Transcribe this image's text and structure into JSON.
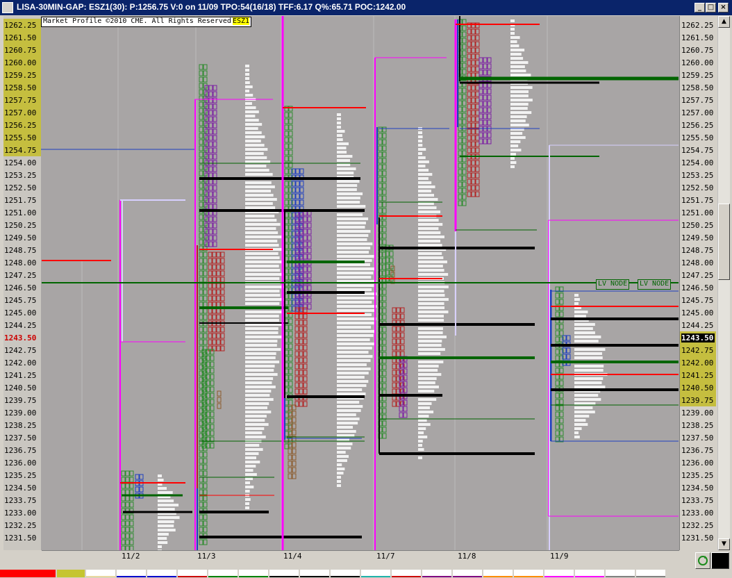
{
  "window": {
    "title": "LISA-30MIN-GAP: ESZ1(30): P:1256.75 V:0 on 11/09 TPO:54(16/18)  TFF:6.17 Q%:65.71 POC:1242.00",
    "minimize": "_",
    "maximize": "□",
    "close": "×"
  },
  "chart_header": {
    "copyright": "Market Profile ©2010 CME. All Rights Reserved",
    "symbol": "ESZ1"
  },
  "price_axis": {
    "prices": [
      "1262.25",
      "1261.50",
      "1260.75",
      "1260.00",
      "1259.25",
      "1258.50",
      "1257.75",
      "1257.00",
      "1256.25",
      "1255.50",
      "1254.75",
      "1254.00",
      "1253.25",
      "1252.50",
      "1251.75",
      "1251.00",
      "1250.25",
      "1249.50",
      "1248.75",
      "1248.00",
      "1247.25",
      "1246.50",
      "1245.75",
      "1245.00",
      "1244.25",
      "1243.50",
      "1242.75",
      "1242.00",
      "1241.25",
      "1240.50",
      "1239.75",
      "1239.00",
      "1238.25",
      "1237.50",
      "1236.75",
      "1236.00",
      "1235.25",
      "1234.50",
      "1233.75",
      "1233.00",
      "1232.25",
      "1231.50"
    ],
    "left_highlight_range": [
      "1262.25",
      "1254.75"
    ],
    "right_highlight_range": [
      "1243.50",
      "1239.75"
    ],
    "current_price_left": "1243.50",
    "current_price_right": "1243.50"
  },
  "dates": [
    "11/2",
    "11/3",
    "11/4",
    "11/7",
    "11/8",
    "11/9"
  ],
  "annotations": {
    "lv_node_1": "LV NODE",
    "lv_node_2": "LV NODE"
  },
  "colors": {
    "chart_bg": "#a8a5a5",
    "title_bg": "#0a246a",
    "highlight": "#c5be3f",
    "green_tpo": "#2e8b2e",
    "red_tpo": "#b22222",
    "purple_tpo": "#7b1fa2",
    "blue_tpo": "#1e3fbf",
    "magenta_line": "#ff00ff"
  },
  "icons": [
    "app-icon",
    "minimize-icon",
    "maximize-icon",
    "close-icon",
    "scroll-up-icon",
    "scroll-down-icon",
    "refresh-icon"
  ]
}
